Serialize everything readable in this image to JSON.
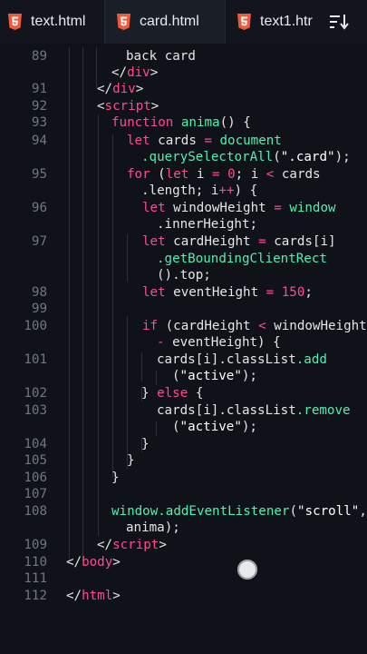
{
  "tabs": [
    {
      "label": "text.html",
      "icon": "html5-icon",
      "active": false
    },
    {
      "label": "card.html",
      "icon": "html5-icon",
      "active": true
    },
    {
      "label": "text1.htr",
      "icon": "html5-icon",
      "active": false
    }
  ],
  "toolbar": {
    "sort_icon": "sort-icon"
  },
  "colors": {
    "background": "#0f1219",
    "tag": "#ff4b8d",
    "keyword": "#ff4b8d",
    "function": "#50f0b0",
    "line_number": "#6f7684",
    "text": "#e6e6e6"
  },
  "lines": [
    {
      "n": "89",
      "segs": [
        [
          "t",
          "back card"
        ]
      ]
    },
    {
      "n": "",
      "segs": [
        [
          "g",
          "</"
        ],
        [
          "tag",
          "div"
        ],
        [
          "g",
          ">"
        ]
      ]
    },
    {
      "n": "91",
      "segs": [
        [
          "g",
          "</"
        ],
        [
          "tag",
          "div"
        ],
        [
          "g",
          ">"
        ]
      ]
    },
    {
      "n": "92",
      "segs": [
        [
          "g",
          "<"
        ],
        [
          "tag",
          "script"
        ],
        [
          "g",
          ">"
        ]
      ]
    },
    {
      "n": "93",
      "segs": [
        [
          "kw",
          "function "
        ],
        [
          "fn",
          "anima"
        ],
        [
          "t",
          "() {"
        ]
      ]
    },
    {
      "n": "94",
      "segs": [
        [
          "kw",
          "let "
        ],
        [
          "t",
          "cards "
        ],
        [
          "kw",
          "= "
        ],
        [
          "fn",
          "document"
        ]
      ]
    },
    {
      "n": "",
      "segs": [
        [
          "fn",
          ".querySelectorAll"
        ],
        [
          "t",
          "("
        ],
        [
          "str",
          "\".card\""
        ],
        [
          "t",
          ");"
        ]
      ]
    },
    {
      "n": "95",
      "segs": [
        [
          "kw",
          "for "
        ],
        [
          "t",
          "("
        ],
        [
          "kw",
          "let "
        ],
        [
          "t",
          "i "
        ],
        [
          "kw",
          "= "
        ],
        [
          "num",
          "0"
        ],
        [
          "t",
          "; i "
        ],
        [
          "kw",
          "< "
        ],
        [
          "t",
          "cards"
        ]
      ]
    },
    {
      "n": "",
      "segs": [
        [
          "t",
          ".length; i"
        ],
        [
          "kw",
          "++"
        ],
        [
          "t",
          ") {"
        ]
      ]
    },
    {
      "n": "96",
      "segs": [
        [
          "kw",
          "let "
        ],
        [
          "t",
          "windowHeight "
        ],
        [
          "kw",
          "= "
        ],
        [
          "fn",
          "window"
        ]
      ]
    },
    {
      "n": "",
      "segs": [
        [
          "t",
          ".innerHeight;"
        ]
      ]
    },
    {
      "n": "97",
      "segs": [
        [
          "kw",
          "let "
        ],
        [
          "t",
          "cardHeight "
        ],
        [
          "kw",
          "= "
        ],
        [
          "t",
          "cards[i]"
        ]
      ]
    },
    {
      "n": "",
      "segs": [
        [
          "fn",
          ".getBoundingClientRect"
        ]
      ]
    },
    {
      "n": "",
      "segs": [
        [
          "t",
          "().top;"
        ]
      ]
    },
    {
      "n": "98",
      "segs": [
        [
          "kw",
          "let "
        ],
        [
          "t",
          "eventHeight "
        ],
        [
          "kw",
          "= "
        ],
        [
          "num",
          "150"
        ],
        [
          "t",
          ";"
        ]
      ]
    },
    {
      "n": "99",
      "segs": []
    },
    {
      "n": "100",
      "segs": [
        [
          "kw",
          "if "
        ],
        [
          "t",
          "(cardHeight "
        ],
        [
          "kw",
          "< "
        ],
        [
          "t",
          "windowHeight"
        ]
      ]
    },
    {
      "n": "",
      "segs": [
        [
          "kw",
          "- "
        ],
        [
          "t",
          "eventHeight) {"
        ]
      ]
    },
    {
      "n": "101",
      "segs": [
        [
          "t",
          "cards[i].classList"
        ],
        [
          "fn",
          ".add"
        ]
      ]
    },
    {
      "n": "",
      "segs": [
        [
          "t",
          "("
        ],
        [
          "str",
          "\"active\""
        ],
        [
          "t",
          ");"
        ]
      ]
    },
    {
      "n": "102",
      "segs": [
        [
          "t",
          "} "
        ],
        [
          "kw",
          "else "
        ],
        [
          "t",
          "{"
        ]
      ]
    },
    {
      "n": "103",
      "segs": [
        [
          "t",
          "cards[i].classList"
        ],
        [
          "fn",
          ".remove"
        ]
      ]
    },
    {
      "n": "",
      "segs": [
        [
          "t",
          "("
        ],
        [
          "str",
          "\"active\""
        ],
        [
          "t",
          ");"
        ]
      ]
    },
    {
      "n": "104",
      "segs": [
        [
          "t",
          "}"
        ]
      ]
    },
    {
      "n": "105",
      "segs": [
        [
          "t",
          "}"
        ]
      ]
    },
    {
      "n": "106",
      "segs": [
        [
          "t",
          "}"
        ]
      ]
    },
    {
      "n": "107",
      "segs": []
    },
    {
      "n": "108",
      "segs": [
        [
          "fn",
          "window.addEventListener"
        ],
        [
          "t",
          "("
        ],
        [
          "str",
          "\"scroll\""
        ],
        [
          "t",
          ","
        ]
      ]
    },
    {
      "n": "",
      "segs": [
        [
          "t",
          "anima);"
        ]
      ]
    },
    {
      "n": "109",
      "segs": [
        [
          "g",
          "</"
        ],
        [
          "tag",
          "script"
        ],
        [
          "g",
          ">"
        ]
      ]
    },
    {
      "n": "110",
      "segs": [
        [
          "g",
          "</"
        ],
        [
          "tag",
          "body"
        ],
        [
          "g",
          ">"
        ]
      ]
    },
    {
      "n": "111",
      "segs": []
    },
    {
      "n": "112",
      "segs": [
        [
          "g",
          "</"
        ],
        [
          "tag",
          "html"
        ],
        [
          "g",
          ">"
        ]
      ]
    }
  ]
}
